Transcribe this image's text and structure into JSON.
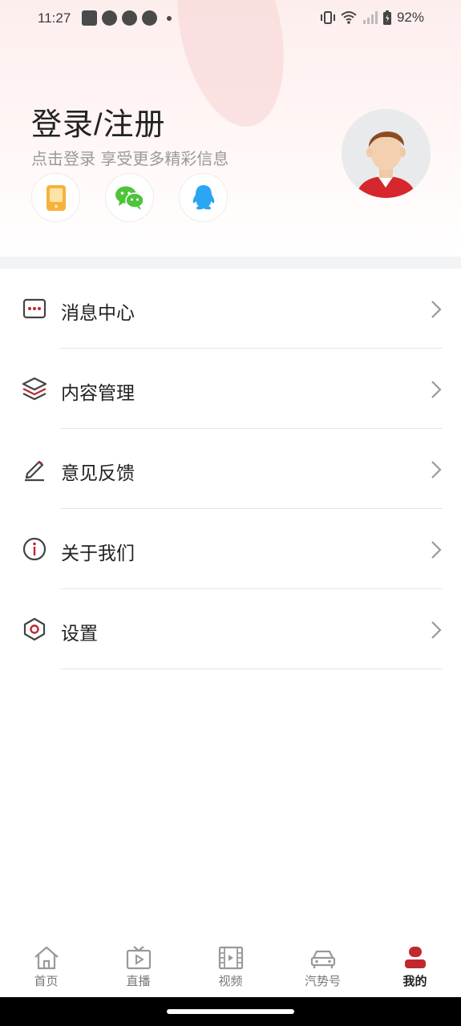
{
  "status_bar": {
    "time": "11:27",
    "battery": "92%"
  },
  "login": {
    "title": "登录/注册",
    "subtitle": "点击登录 享受更多精彩信息",
    "methods": [
      {
        "name": "phone-login",
        "icon": "phone-icon",
        "color": "#f6b23c"
      },
      {
        "name": "wechat-login",
        "icon": "wechat-icon",
        "color": "#4fc33a"
      },
      {
        "name": "qq-login",
        "icon": "qq-icon",
        "color": "#2aa6f2"
      }
    ]
  },
  "menu": [
    {
      "label": "消息中心",
      "icon": "message-icon"
    },
    {
      "label": "内容管理",
      "icon": "layers-icon"
    },
    {
      "label": "意见反馈",
      "icon": "pencil-icon"
    },
    {
      "label": "关于我们",
      "icon": "info-icon"
    },
    {
      "label": "设置",
      "icon": "settings-hex-icon"
    }
  ],
  "tabs": [
    {
      "label": "首页",
      "icon": "home-icon",
      "active": false
    },
    {
      "label": "直播",
      "icon": "tv-icon",
      "active": false
    },
    {
      "label": "视频",
      "icon": "video-icon",
      "active": false
    },
    {
      "label": "汽势号",
      "icon": "car-icon",
      "active": false
    },
    {
      "label": "我的",
      "icon": "user-icon",
      "active": true
    }
  ],
  "colors": {
    "accent": "#c0282d",
    "icon_gray": "#444444",
    "tab_gray": "#999999"
  }
}
